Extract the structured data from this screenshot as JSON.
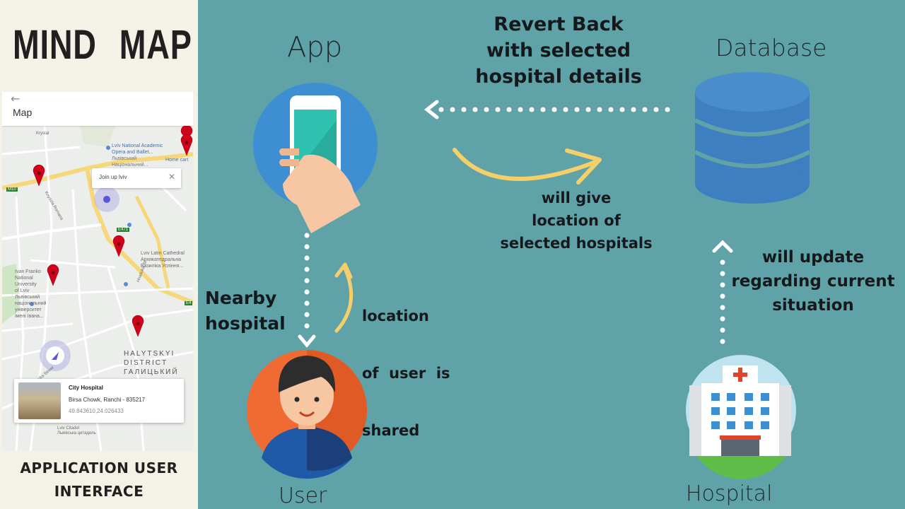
{
  "left_panel": {
    "title": "MIND  MAP",
    "caption_line1": "APPLICATION USER",
    "caption_line2": "INTERFACE"
  },
  "phone": {
    "back_icon": "arrow-left-icon",
    "appbar_title": "Map",
    "join_label": "Join up lviv",
    "join_close": "✕",
    "map_labels": {
      "opera": "Lviv National Academic",
      "opera2": "Opera and Ballet...",
      "opera3": "Львівський",
      "opera4": "Національний...",
      "home_cart": "Home cart",
      "latin": "Lviv Latin Cathedral",
      "latin2": "Архикатедральна",
      "latin3": "Базиліка Успіння...",
      "franko1": "Ivan Franko",
      "franko2": "National",
      "franko3": "University",
      "franko4": "of Lviv",
      "franko5": "Львівський",
      "franko6": "національний",
      "franko7": "університет",
      "franko8": "імені Івана...",
      "district1": "HALYTSKYI",
      "district2": "DISTRICT",
      "district3": "ГАЛИЦЬКИЙ",
      "street1": "Petra Doroshenka Street",
      "citadel": "Львівська цитадель",
      "citadel0": "Lviv Citadel",
      "m10": "M10",
      "e471": "E471",
      "e4": "E4",
      "street2": "Knyazia Romana",
      "street3": "Hnatiuka St",
      "krystal": "Krystal"
    },
    "card": {
      "name": "City Hospital",
      "address": "Birsa Chowk, Ranchi - 835217",
      "coords": "49.843610,24.026433"
    }
  },
  "diagram": {
    "app_label": "App",
    "database_label": "Database",
    "user_label": "User",
    "hospital_label": "Hospital",
    "revert_line1": "Revert Back",
    "revert_line2": "with selected",
    "revert_line3": "hospital details",
    "give_line1": "will give",
    "give_line2": "location of",
    "give_line3": "selected hospitals",
    "update_line1": "will update",
    "update_line2": "regarding current",
    "update_line3": "situation",
    "nearby_line1": "Nearby",
    "nearby_line2": "hospital",
    "shared_line1": "location",
    "shared_line2": "of  user  is",
    "shared_line3": "shared"
  },
  "colors": {
    "background": "#5fa3a8",
    "panel": "#f4f1e6",
    "arrow_yellow": "#f5cf6a",
    "app_circle": "#3d8fd1",
    "user_circle": "#f06a33",
    "database": "#3d7fc0",
    "hospital_circle": "#bfe4f0"
  }
}
